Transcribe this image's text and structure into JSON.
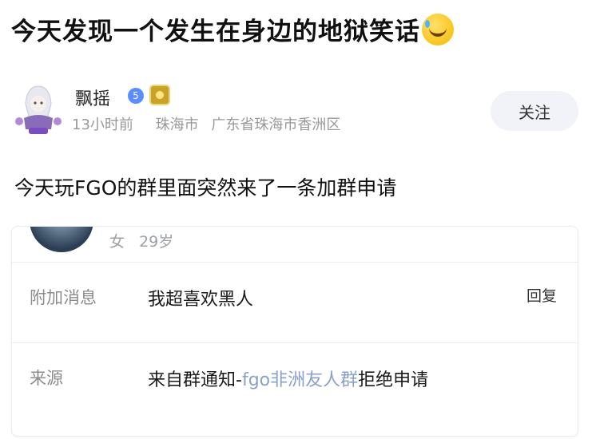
{
  "post": {
    "title": "今天发现一个发生在身边的地狱笑话",
    "title_emoji": "laugh-cry-icon",
    "author": {
      "name": "飘摇",
      "vip_level": "5",
      "time": "13小时前",
      "city": "珠海市",
      "location": "广东省珠海市香洲区"
    },
    "follow_label": "关注",
    "body": "今天玩FGO的群里面突然来了一条加群申请"
  },
  "request_card": {
    "gender": "女",
    "age": "29岁",
    "message_label": "附加消息",
    "message_value": "我超喜欢黑人",
    "reply_label": "回复",
    "source_label": "来源",
    "source_prefix": "来自群通知-",
    "source_group": "fgo非洲友人群",
    "source_suffix": "拒绝申请"
  },
  "colors": {
    "accent_blue": "#5b8dff",
    "group_link": "#8aa2c8",
    "follow_bg": "#f2f3f8"
  }
}
